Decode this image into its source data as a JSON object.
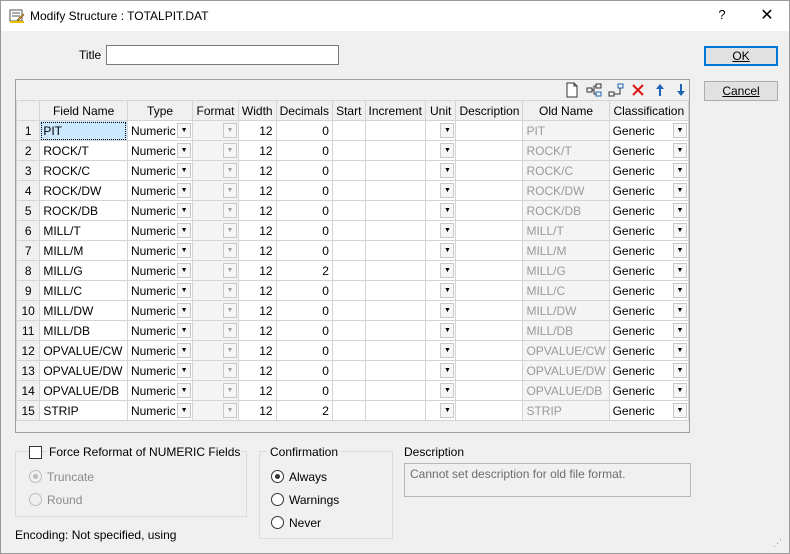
{
  "window": {
    "title": "Modify Structure : TOTALPIT.DAT",
    "help": "?",
    "close": "✕"
  },
  "form": {
    "title_label": "Title",
    "title_value": ""
  },
  "buttons": {
    "ok": "OK",
    "cancel": "Cancel"
  },
  "toolbar": {
    "icons": [
      "new-icon",
      "insert-field-icon",
      "append-field-icon",
      "delete-icon",
      "move-up-icon",
      "move-down-icon"
    ]
  },
  "columns": [
    "Field Name",
    "Type",
    "Format",
    "Width",
    "Decimals",
    "Start",
    "Increment",
    "Unit",
    "Description",
    "Old Name",
    "Classification"
  ],
  "rows": [
    {
      "n": "1",
      "name": "PIT",
      "type": "Numeric",
      "width": "12",
      "dec": "0",
      "old": "PIT",
      "cls": "Generic"
    },
    {
      "n": "2",
      "name": "ROCK/T",
      "type": "Numeric",
      "width": "12",
      "dec": "0",
      "old": "ROCK/T",
      "cls": "Generic"
    },
    {
      "n": "3",
      "name": "ROCK/C",
      "type": "Numeric",
      "width": "12",
      "dec": "0",
      "old": "ROCK/C",
      "cls": "Generic"
    },
    {
      "n": "4",
      "name": "ROCK/DW",
      "type": "Numeric",
      "width": "12",
      "dec": "0",
      "old": "ROCK/DW",
      "cls": "Generic"
    },
    {
      "n": "5",
      "name": "ROCK/DB",
      "type": "Numeric",
      "width": "12",
      "dec": "0",
      "old": "ROCK/DB",
      "cls": "Generic"
    },
    {
      "n": "6",
      "name": "MILL/T",
      "type": "Numeric",
      "width": "12",
      "dec": "0",
      "old": "MILL/T",
      "cls": "Generic"
    },
    {
      "n": "7",
      "name": "MILL/M",
      "type": "Numeric",
      "width": "12",
      "dec": "0",
      "old": "MILL/M",
      "cls": "Generic"
    },
    {
      "n": "8",
      "name": "MILL/G",
      "type": "Numeric",
      "width": "12",
      "dec": "2",
      "old": "MILL/G",
      "cls": "Generic"
    },
    {
      "n": "9",
      "name": "MILL/C",
      "type": "Numeric",
      "width": "12",
      "dec": "0",
      "old": "MILL/C",
      "cls": "Generic"
    },
    {
      "n": "10",
      "name": "MILL/DW",
      "type": "Numeric",
      "width": "12",
      "dec": "0",
      "old": "MILL/DW",
      "cls": "Generic"
    },
    {
      "n": "11",
      "name": "MILL/DB",
      "type": "Numeric",
      "width": "12",
      "dec": "0",
      "old": "MILL/DB",
      "cls": "Generic"
    },
    {
      "n": "12",
      "name": "OPVALUE/CW",
      "type": "Numeric",
      "width": "12",
      "dec": "0",
      "old": "OPVALUE/CW",
      "cls": "Generic"
    },
    {
      "n": "13",
      "name": "OPVALUE/DW",
      "type": "Numeric",
      "width": "12",
      "dec": "0",
      "old": "OPVALUE/DW",
      "cls": "Generic"
    },
    {
      "n": "14",
      "name": "OPVALUE/DB",
      "type": "Numeric",
      "width": "12",
      "dec": "0",
      "old": "OPVALUE/DB",
      "cls": "Generic"
    },
    {
      "n": "15",
      "name": "STRIP",
      "type": "Numeric",
      "width": "12",
      "dec": "2",
      "old": "STRIP",
      "cls": "Generic"
    }
  ],
  "reformat": {
    "label": "Force Reformat of NUMERIC Fields",
    "checked": false,
    "truncate": "Truncate",
    "round": "Round"
  },
  "confirmation": {
    "title": "Confirmation",
    "always": "Always",
    "warnings": "Warnings",
    "never": "Never",
    "selected": "Always"
  },
  "description": {
    "title": "Description",
    "text": "Cannot set description for old file format."
  },
  "encoding": "Encoding: Not specified, using"
}
